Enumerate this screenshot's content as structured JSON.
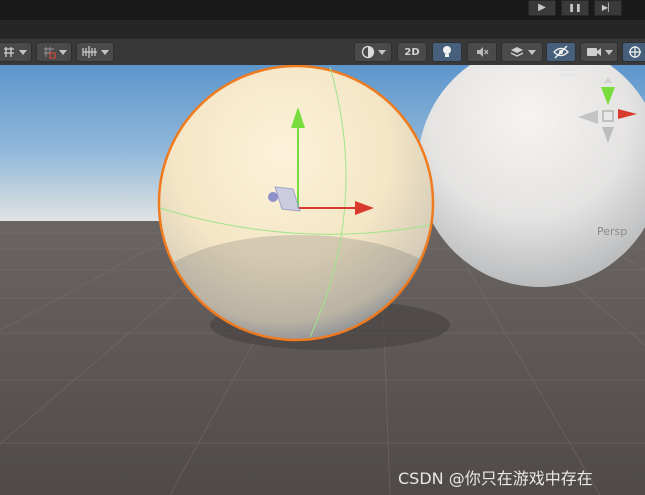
{
  "playbar": {
    "controls": [
      {
        "name": "play",
        "glyph": "▶"
      },
      {
        "name": "pause",
        "glyph": "❚❚"
      },
      {
        "name": "step",
        "glyph": "▶▏"
      }
    ]
  },
  "toolbar": {
    "left_tools": [
      "grid-snapping-icon",
      "increment-snap-icon",
      "ruler-grid-icon"
    ],
    "shading_mode_icon": "shading-sphere-icon",
    "twod_label": "2D",
    "lighting_icon": "lightbulb-icon",
    "audio_icon": "audio-mute-icon",
    "effects_icon": "effects-layers-icon",
    "visibility_icon": "scene-visibility-icon",
    "camera_icon": "camera-icon",
    "gizmos_icon": "gizmos-icon"
  },
  "viewport": {
    "projection_label": "Persp",
    "selected_object": "sphere",
    "colors": {
      "sky_top": "#5d96cc",
      "horizon": "#cfd9df",
      "ground": "#5a5451",
      "selected_outline": "#f07a1e",
      "x_axis": "#d83a2e",
      "y_axis": "#78dd3c",
      "z_axis": "#3c82f0"
    }
  },
  "watermark": "CSDN @你只在游戏中存在"
}
